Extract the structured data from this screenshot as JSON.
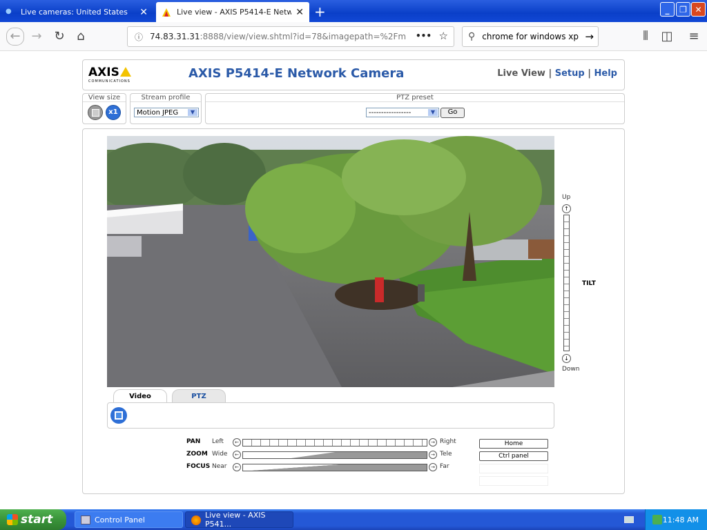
{
  "browser": {
    "tabs": [
      {
        "label": "Live cameras: United States",
        "active": false
      },
      {
        "label": "Live view - AXIS P5414-E Network",
        "active": true
      }
    ],
    "url_host": "74.83.31.31",
    "url_path": ":8888/view/view.shtml?id=78&imagepath=%2Fm",
    "search_value": "chrome for windows xp"
  },
  "camera_page": {
    "logo_text": "AXIS",
    "logo_sub": "COMMUNICATIONS",
    "title": "AXIS P5414-E Network Camera",
    "nav": {
      "live_view": "Live View",
      "setup": "Setup",
      "help": "Help",
      "sep": "|"
    },
    "view_size_label": "View size",
    "view_size_x1": "x1",
    "stream_profile_label": "Stream profile",
    "stream_profile_value": "Motion JPEG",
    "ptz_preset_label": "PTZ preset",
    "ptz_preset_value": "-----------------",
    "go_label": "Go",
    "tilt": {
      "up": "Up",
      "label": "TILT",
      "down": "Down"
    },
    "tabs": {
      "video": "Video",
      "ptz": "PTZ"
    },
    "controls": {
      "pan": {
        "label": "PAN",
        "left": "Left",
        "right": "Right"
      },
      "zoom": {
        "label": "ZOOM",
        "left": "Wide",
        "right": "Tele"
      },
      "focus": {
        "label": "FOCUS",
        "left": "Near",
        "right": "Far"
      }
    },
    "home_label": "Home",
    "ctrl_panel_label": "Ctrl panel"
  },
  "taskbar": {
    "start": "start",
    "tasks": [
      {
        "label": "Control Panel"
      },
      {
        "label": "Live view - AXIS P541..."
      }
    ],
    "clock": "11:48 AM"
  },
  "colors": {
    "accent": "#2b5aa8",
    "taskbar": "#2458d6",
    "start": "#3a943a"
  }
}
